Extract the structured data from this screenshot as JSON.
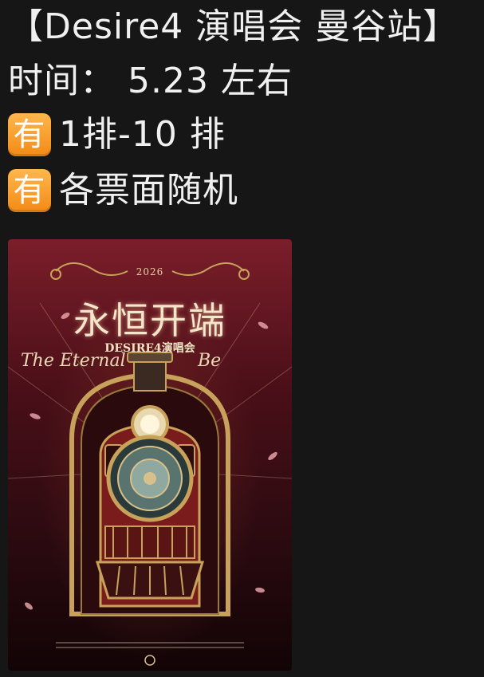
{
  "post": {
    "line1": "【Desire4 演唱会 曼谷站】",
    "line2": "时间： 5.23 左右",
    "line3_badge": "有",
    "line3_text": "1排-10 排",
    "line4_badge": "有",
    "line4_text": "各票面随机"
  },
  "poster": {
    "year": "2026",
    "title_cn": "永恒开端",
    "subtitle": "DESIRE4演唱会",
    "title_en_left": "The Eternal",
    "title_en_right": "Be",
    "colors": {
      "background_top": "#7b1e2a",
      "background_bottom": "#120406",
      "gold": "#c8a25a",
      "train_red": "#7a1c1c"
    }
  }
}
